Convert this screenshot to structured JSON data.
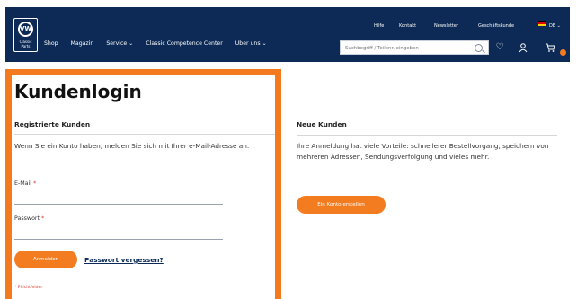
{
  "header": {
    "logo_text": "Classic Parts",
    "logo_mark": "VW",
    "nav": [
      "Shop",
      "Magazin",
      "Service ⌄",
      "Classic Competence Center",
      "Über uns ⌄"
    ],
    "top_links": [
      "Hilfe",
      "Kontakt",
      "Newsletter",
      "Geschäftskunde",
      "DE ⌄"
    ],
    "search_placeholder": "Suchbegriff / Teilenr. eingeben",
    "icons": [
      "search-icon",
      "heart-icon",
      "user-icon",
      "cart-icon"
    ],
    "colors": {
      "bar": "#0c2a55",
      "accent": "#f47c20"
    }
  },
  "login": {
    "title": "Kundenlogin",
    "section_title": "Registrierte Kunden",
    "intro": "Wenn Sie ein Konto haben, melden Sie sich mit Ihrer e-Mail-Adresse an.",
    "email_label": "E-Mail",
    "password_label": "Passwort",
    "required_mark": "*",
    "login_button": "Anmelden",
    "forgot_link": "Passwort vergessen?",
    "required_note": "* Pflichtfelder"
  },
  "new_customers": {
    "section_title": "Neue Kunden",
    "text": "Ihre Anmeldung hat viele Vorteile: schnellerer Bestellvorgang, speichern von mehreren Adressen, Sendungsverfolgung und vieles mehr.",
    "create_button": "Ein Konto erstellen"
  }
}
